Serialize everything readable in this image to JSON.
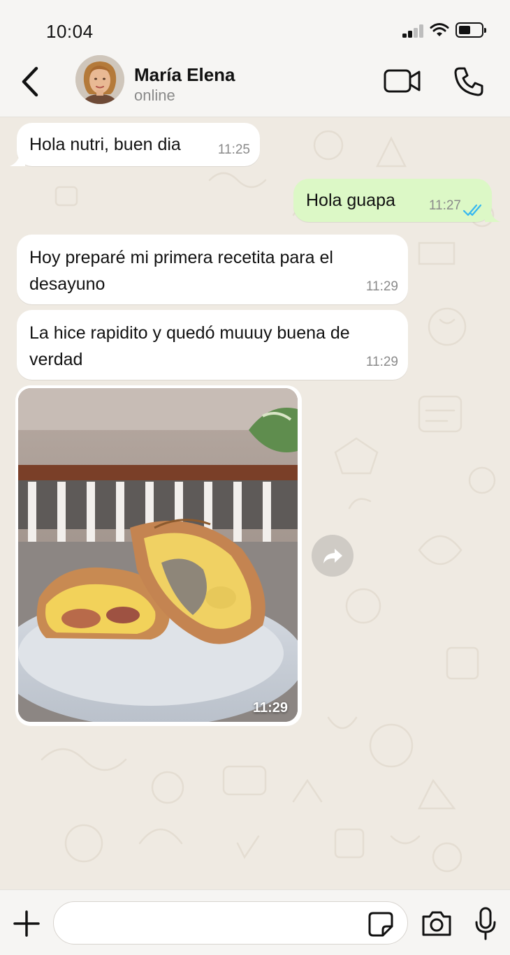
{
  "status_bar": {
    "time": "10:04",
    "battery_level": 0.45
  },
  "contact": {
    "name": "María Elena",
    "presence": "online"
  },
  "header_icons": [
    "back-icon",
    "video-call-icon",
    "phone-icon"
  ],
  "messages": [
    {
      "direction": "incoming",
      "text": "Hola nutri, buen dia",
      "time": "11:25"
    },
    {
      "direction": "outgoing",
      "text": "Hola guapa",
      "time": "11:27",
      "status": "read"
    },
    {
      "direction": "incoming",
      "text": "Hoy preparé mi primera recetita para el desayuno",
      "time": "11:29"
    },
    {
      "direction": "incoming",
      "text": "La hice rapidito y quedó muuuy buena de verdad",
      "time": "11:29"
    },
    {
      "direction": "incoming",
      "type": "image",
      "subject": "breakfast burrito",
      "time": "11:29"
    }
  ],
  "composer": {
    "placeholder": "",
    "icons": [
      "plus-icon",
      "sticker-icon",
      "camera-icon",
      "microphone-icon"
    ]
  },
  "colors": {
    "outgoing_bubble": "#dcf8c6",
    "incoming_bubble": "#ffffff",
    "chat_background": "#efeae2",
    "read_ticks": "#34b7f1"
  }
}
